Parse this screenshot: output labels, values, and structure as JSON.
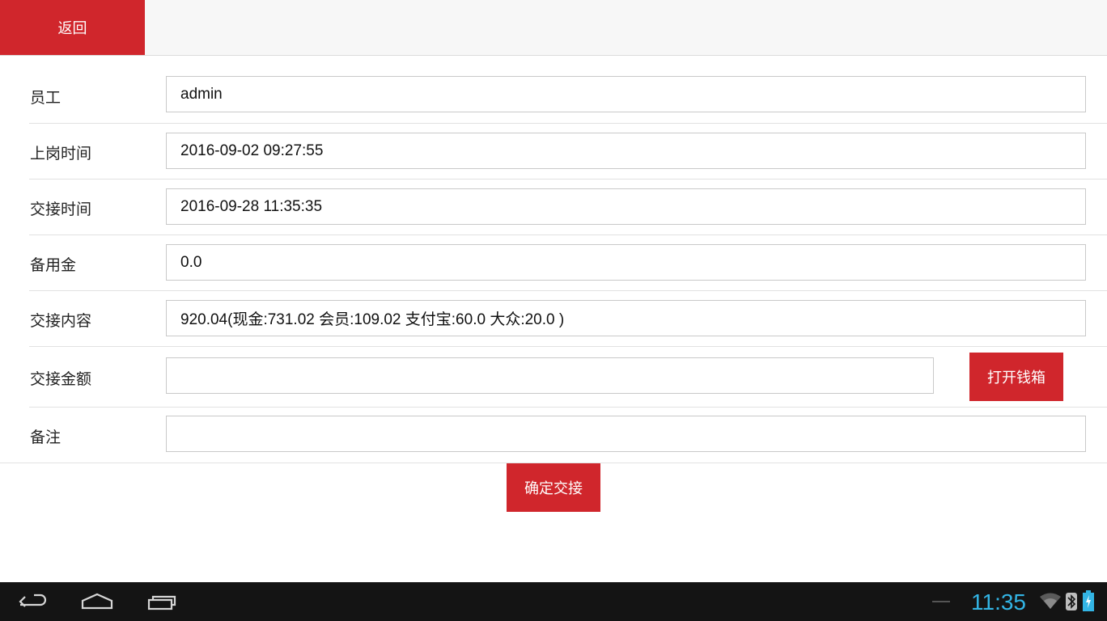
{
  "header": {
    "back_label": "返回"
  },
  "form": {
    "employee": {
      "label": "员工",
      "value": "admin"
    },
    "start_time": {
      "label": "上岗时间",
      "value": "2016-09-02 09:27:55"
    },
    "handover_time": {
      "label": "交接时间",
      "value": "2016-09-28 11:35:35"
    },
    "reserve_fund": {
      "label": "备用金",
      "value": "0.0"
    },
    "handover_content": {
      "label": "交接内容",
      "value": "920.04(现金:731.02 会员:109.02 支付宝:60.0 大众:20.0 )"
    },
    "handover_amount": {
      "label": "交接金额",
      "value": "",
      "button_label": "打开钱箱"
    },
    "remark": {
      "label": "备注",
      "value": ""
    }
  },
  "actions": {
    "confirm_label": "确定交接"
  },
  "system_bar": {
    "time": "11:35",
    "clock_color": "#33b5e5",
    "icons": [
      "back-icon",
      "home-icon",
      "recent-apps-icon",
      "wifi-icon",
      "bluetooth-icon",
      "battery-icon"
    ]
  },
  "colors": {
    "accent": "#d0262c",
    "topbar": "#f7f7f7",
    "navbar": "#141414"
  }
}
